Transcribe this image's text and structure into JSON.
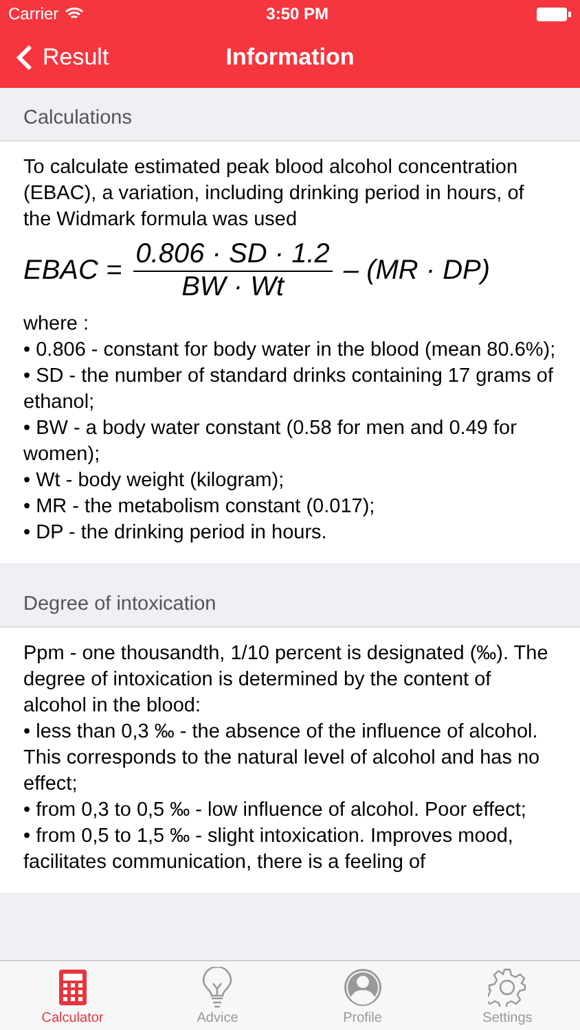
{
  "status_bar": {
    "carrier": "Carrier",
    "time": "3:50 PM"
  },
  "nav": {
    "back": "Result",
    "title": "Information"
  },
  "sections": [
    {
      "header": "Calculations",
      "blocks": [
        {
          "kind": "text",
          "text": "To calculate estimated peak blood alcohol concentration (EBAC), a variation, including drinking period in hours, of the Widmark formula was used"
        },
        {
          "kind": "formula",
          "lhs": "EBAC =",
          "numerator": "0.806 · SD · 1.2",
          "denominator": "BW · Wt",
          "rhs": "– (MR · DP)"
        },
        {
          "kind": "text",
          "text": "where :"
        },
        {
          "kind": "text",
          "text": "• 0.806 - constant for body water in the blood (mean 80.6%);"
        },
        {
          "kind": "text",
          "text": "• SD - the number of standard drinks containing 17 grams of ethanol;"
        },
        {
          "kind": "text",
          "text": "• BW - a body water constant (0.58 for men and 0.49 for women);"
        },
        {
          "kind": "text",
          "text": "• Wt - body weight (kilogram);"
        },
        {
          "kind": "text",
          "text": "• MR - the metabolism constant (0.017);"
        },
        {
          "kind": "text",
          "text": "• DP - the drinking period in hours."
        }
      ]
    },
    {
      "header": "Degree of intoxication",
      "blocks": [
        {
          "kind": "text",
          "text": "Ppm - one thousandth, 1/10 percent is designated (‰). The degree of intoxication is determined by the content of alcohol in the blood:"
        },
        {
          "kind": "text",
          "text": "• less than 0,3 ‰ - the absence of the influence of alcohol. This corresponds to the natural level of alcohol and has no effect;"
        },
        {
          "kind": "text",
          "text": "• from 0,3 to 0,5 ‰ - low influence of alcohol. Poor effect;"
        },
        {
          "kind": "text",
          "text": "• from 0,5 to 1,5 ‰ - slight intoxication. Improves mood, facilitates communication, there is a feeling of"
        }
      ]
    }
  ],
  "tabs": [
    {
      "label": "Calculator",
      "selected": true
    },
    {
      "label": "Advice",
      "selected": false
    },
    {
      "label": "Profile",
      "selected": false
    },
    {
      "label": "Settings",
      "selected": false
    }
  ]
}
